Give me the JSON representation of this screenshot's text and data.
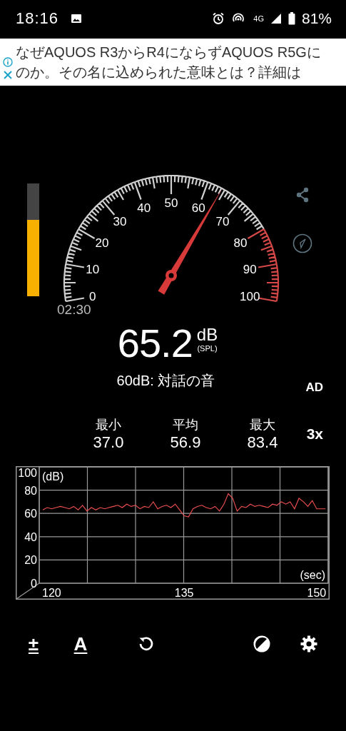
{
  "status_bar": {
    "time": "18:16",
    "network": "4G",
    "battery": "81%"
  },
  "ad": {
    "lines": [
      "なぜAQUOS R3からR4にならずAQUOS R5Gに",
      "のか。その名に込められた意味とは？詳細は"
    ]
  },
  "level_meter": {
    "level": 0.68
  },
  "gauge": {
    "scale": [
      {
        "label": "0",
        "warning": false
      },
      {
        "label": "10",
        "warning": false
      },
      {
        "label": "20",
        "warning": false
      },
      {
        "label": "30",
        "warning": false
      },
      {
        "label": "40",
        "warning": false
      },
      {
        "label": "50",
        "warning": false
      },
      {
        "label": "60",
        "warning": false
      },
      {
        "label": "70",
        "warning": false
      },
      {
        "label": "80",
        "warning": true
      },
      {
        "label": "90",
        "warning": true
      },
      {
        "label": "100",
        "warning": true
      }
    ]
  },
  "timer": "02:30",
  "reading": {
    "value": "65.2",
    "unit": "dB",
    "weighting": "(SPL)"
  },
  "description": "60dB: 対話の音",
  "ad_badge": "AD",
  "stats": [
    {
      "label": "最小",
      "value": "37.0"
    },
    {
      "label": "平均",
      "value": "56.9"
    },
    {
      "label": "最大",
      "value": "83.4"
    }
  ],
  "zoom_button": "3x",
  "chart": {
    "chart_data": {
      "type": "line",
      "grid": true,
      "xlabel": "(sec)",
      "ylabel": "(dB)",
      "xlim": [
        118.6,
        151.3
      ],
      "ylim": [
        0,
        100
      ],
      "xticks": [
        120,
        135,
        150
      ],
      "yticks": [
        0,
        20,
        40,
        60,
        80,
        100
      ],
      "x": [
        119,
        119.5,
        120,
        120.5,
        121,
        121.5,
        122,
        122.5,
        123,
        123.5,
        124,
        124.5,
        125,
        125.5,
        126,
        126.5,
        127,
        127.5,
        128,
        128.5,
        129,
        129.5,
        130,
        130.5,
        131,
        131.5,
        132,
        132.5,
        133,
        133.5,
        134,
        134.5,
        135,
        135.5,
        136,
        136.5,
        137,
        137.5,
        138,
        138.5,
        139,
        139.5,
        140,
        140.5,
        141,
        141.5,
        142,
        142.5,
        143,
        143.5,
        144,
        144.5,
        145,
        145.5,
        146,
        146.5,
        147,
        147.5,
        148,
        148.5,
        149,
        149.5,
        150,
        150.5,
        151
      ],
      "series": [
        {
          "color": "#f05050",
          "values": [
            63,
            65,
            64,
            65,
            66,
            65,
            64,
            66,
            63,
            67,
            62,
            65,
            63,
            65,
            64,
            65,
            66,
            67,
            65,
            68,
            66,
            67,
            64,
            66,
            65,
            70,
            64,
            66,
            67,
            65,
            68,
            63,
            58,
            57,
            64,
            66,
            67,
            65,
            64,
            66,
            62,
            68,
            77,
            73,
            62,
            66,
            65,
            68,
            66,
            67,
            66,
            65,
            68,
            67,
            70,
            68,
            70,
            64,
            73,
            70,
            66,
            71,
            64,
            64,
            64
          ]
        }
      ]
    }
  },
  "toolbar": [
    {
      "kind": "text",
      "label": "±"
    },
    {
      "kind": "text",
      "label": "A"
    },
    {
      "kind": "reset"
    },
    {
      "kind": "contrast"
    },
    {
      "kind": "settings"
    }
  ]
}
